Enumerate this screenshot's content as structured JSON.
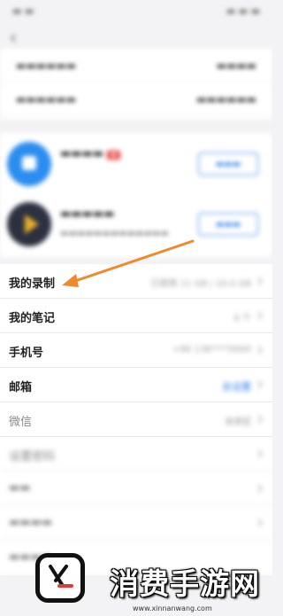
{
  "colors": {
    "accent": "#2b7de9",
    "arrow": "#f0892b",
    "badge": "#e53935",
    "watermark_logo": "#e53935"
  },
  "rows": [
    {
      "label": "我的录制",
      "value": "已使用 11 GB / 10.0 GB"
    },
    {
      "label": "我的笔记",
      "value": "0 个"
    },
    {
      "label": "手机号",
      "value": "+86 138****0000"
    },
    {
      "label": "邮箱",
      "value": "去设置"
    },
    {
      "label": "微信",
      "value": "未绑定"
    },
    {
      "label": "设置密码",
      "value": ""
    },
    {
      "label": "",
      "value": ""
    },
    {
      "label": "",
      "value": ""
    },
    {
      "label": "",
      "value": ""
    }
  ],
  "watermark": {
    "text": "消费手游网",
    "url": "www.xinnanwang.com"
  }
}
